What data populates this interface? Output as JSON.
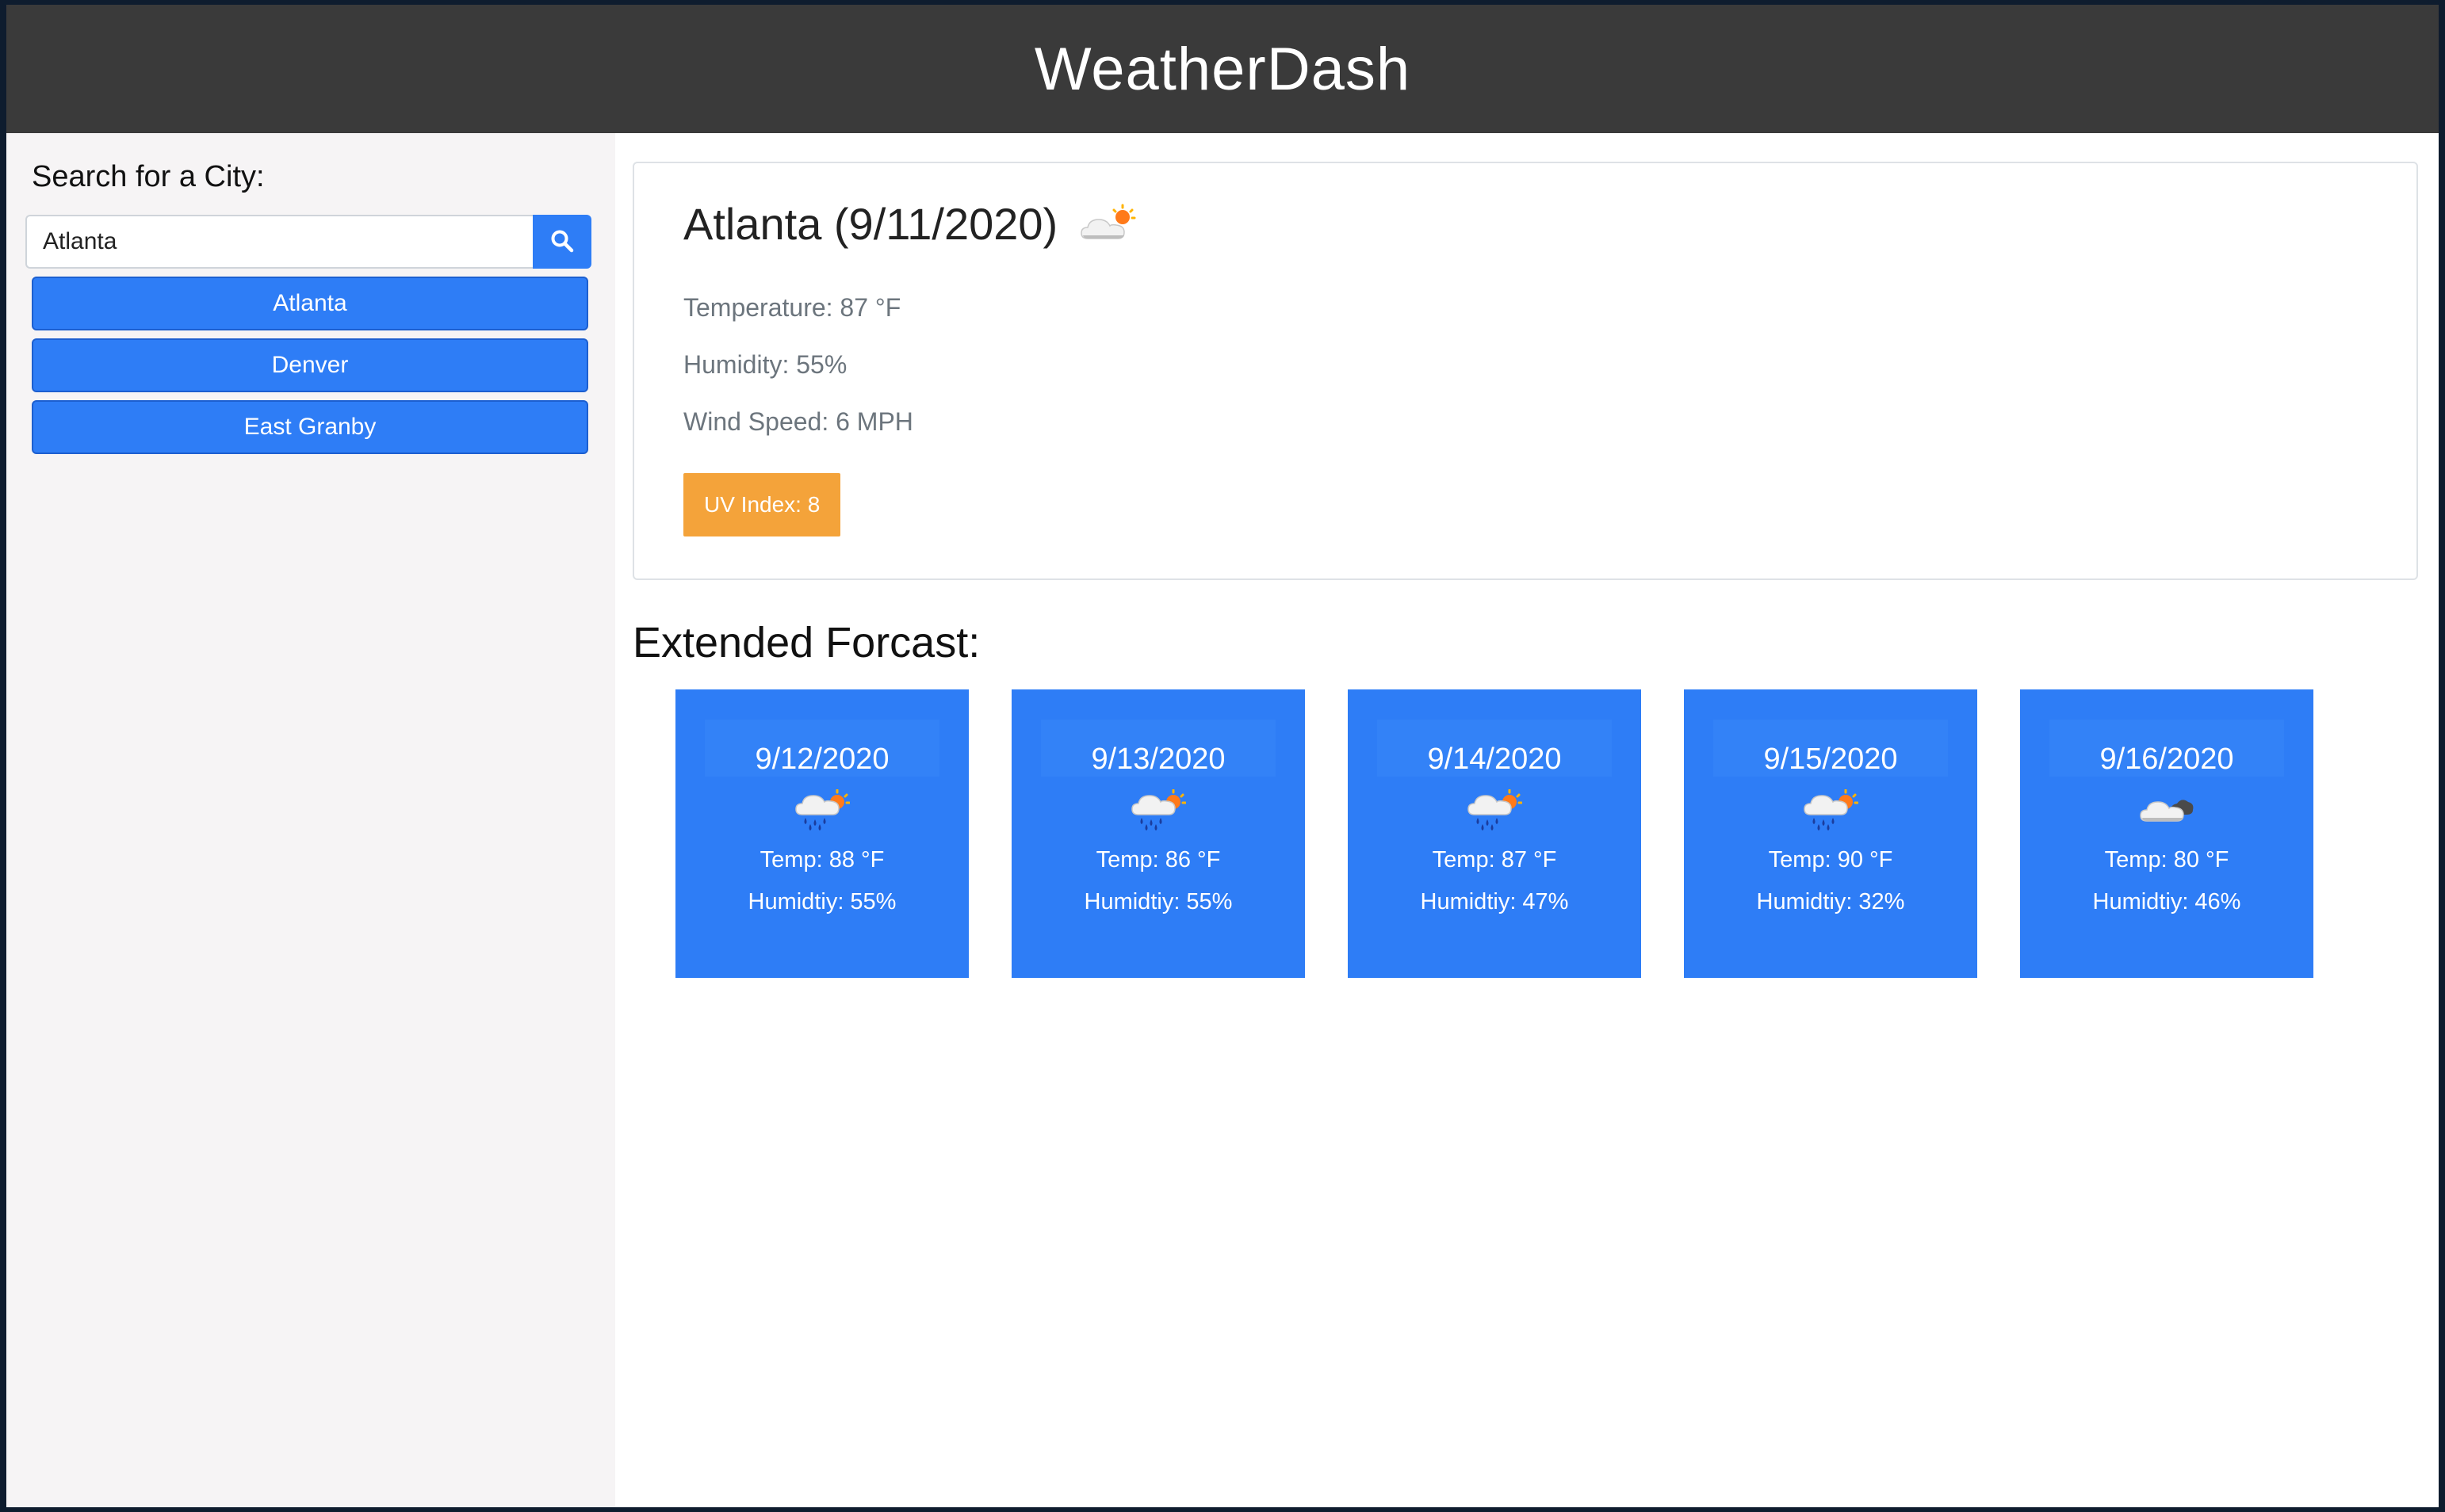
{
  "app": {
    "title": "WeatherDash"
  },
  "sidebar": {
    "search_label": "Search for a City:",
    "search_value": "Atlanta",
    "search_icon": "search-icon",
    "cities": [
      "Atlanta",
      "Denver",
      "East Granby"
    ]
  },
  "current": {
    "title": "Atlanta (9/11/2020)",
    "icon": "partly-cloudy-icon",
    "temperature": "Temperature: 87 °F",
    "humidity": "Humidity: 55%",
    "wind": "Wind Speed: 6 MPH",
    "uv": "UV Index: 8"
  },
  "forecast": {
    "heading": "Extended Forcast:",
    "days": [
      {
        "date": "9/12/2020",
        "icon": "rain-sun-icon",
        "temp": "Temp: 88 °F",
        "humidity": "Humidtiy: 55%"
      },
      {
        "date": "9/13/2020",
        "icon": "rain-sun-icon",
        "temp": "Temp: 86 °F",
        "humidity": "Humidtiy: 55%"
      },
      {
        "date": "9/14/2020",
        "icon": "rain-sun-icon",
        "temp": "Temp: 87 °F",
        "humidity": "Humidtiy: 47%"
      },
      {
        "date": "9/15/2020",
        "icon": "rain-sun-icon",
        "temp": "Temp: 90 °F",
        "humidity": "Humidtiy: 32%"
      },
      {
        "date": "9/16/2020",
        "icon": "cloudy-icon",
        "temp": "Temp: 80 °F",
        "humidity": "Humidtiy: 46%"
      }
    ]
  },
  "colors": {
    "header": "#3a3a3a",
    "accent": "#2e7df6",
    "uv_badge": "#f4a33a",
    "sidebar": "#f6f4f5"
  }
}
